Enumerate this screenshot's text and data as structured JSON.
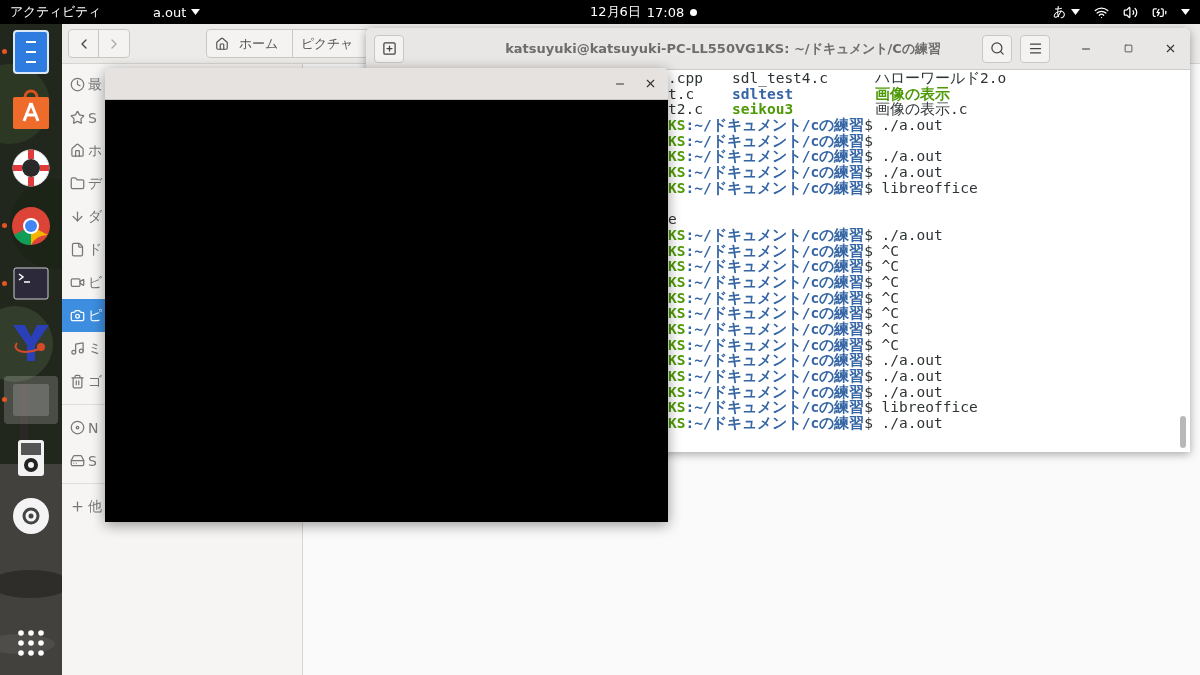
{
  "top_bar": {
    "activities": "アクティビティ",
    "app_menu": "a.out",
    "date": "12月6日",
    "time": "17:08",
    "input_method": "あ"
  },
  "dock": {
    "apps": [
      {
        "running": true,
        "selected": false
      },
      {
        "running": false,
        "selected": false
      },
      {
        "running": false,
        "selected": false
      },
      {
        "running": true,
        "selected": false
      },
      {
        "running": true,
        "selected": false
      },
      {
        "running": false,
        "selected": false
      },
      {
        "running": true,
        "selected": true
      },
      {
        "running": false,
        "selected": false
      },
      {
        "running": false,
        "selected": false
      }
    ]
  },
  "file_manager": {
    "path": [
      "ホーム",
      "ピクチャ"
    ],
    "sidebar": {
      "sections": [
        {
          "items": [
            {
              "label": "最",
              "selected": false
            },
            {
              "label": "S",
              "selected": false
            },
            {
              "label": "ホ",
              "selected": false
            },
            {
              "label": "デ",
              "selected": false
            },
            {
              "label": "ダ",
              "selected": false
            },
            {
              "label": "ド",
              "selected": false
            },
            {
              "label": "ビ",
              "selected": false
            },
            {
              "label": "ピ",
              "selected": true
            },
            {
              "label": "ミ",
              "selected": false
            },
            {
              "label": "ゴ",
              "selected": false
            }
          ]
        },
        {
          "items": [
            {
              "label": "N",
              "selected": false
            },
            {
              "label": "S",
              "selected": false
            }
          ]
        },
        {
          "items": [
            {
              "label": "他",
              "selected": false
            }
          ]
        }
      ]
    }
  },
  "terminal": {
    "title": "katsuyuki@katsuyuki-PC-LL550VG1KS: ~/ドキュメント/Cの練習",
    "lines": [
      {
        "kind": "listing",
        "cells": [
          {
            "text": ".cpp",
            "kind": "file"
          },
          {
            "text": "sdl_test4.c",
            "kind": "file"
          },
          {
            "text": "ハローワールド2.o",
            "kind": "file"
          }
        ]
      },
      {
        "kind": "listing",
        "cells": [
          {
            "text": "t.c",
            "kind": "file"
          },
          {
            "text": "sdltest",
            "kind": "directory"
          },
          {
            "text": "画像の表示",
            "kind": "executable"
          }
        ]
      },
      {
        "kind": "listing",
        "cells": [
          {
            "text": "t2.c",
            "kind": "file"
          },
          {
            "text": "seikou3",
            "kind": "executable"
          },
          {
            "text": "画像の表示.c",
            "kind": "file"
          }
        ]
      },
      {
        "kind": "prompt",
        "user": "KS",
        "path": ":~/ドキュメント/cの練習",
        "command": "$ ./a.out"
      },
      {
        "kind": "prompt",
        "user": "KS",
        "path": ":~/ドキュメント/cの練習",
        "command": "$"
      },
      {
        "kind": "prompt",
        "user": "KS",
        "path": ":~/ドキュメント/cの練習",
        "command": "$ ./a.out"
      },
      {
        "kind": "prompt",
        "user": "KS",
        "path": ":~/ドキュメント/cの練習",
        "command": "$ ./a.out"
      },
      {
        "kind": "prompt",
        "user": "KS",
        "path": ":~/ドキュメント/cの練習",
        "command": "$ libreoffice"
      },
      {
        "kind": "blank"
      },
      {
        "kind": "output",
        "text": "e"
      },
      {
        "kind": "prompt",
        "user": "KS",
        "path": ":~/ドキュメント/cの練習",
        "command": "$ ./a.out"
      },
      {
        "kind": "prompt",
        "user": "KS",
        "path": ":~/ドキュメント/cの練習",
        "command": "$ ^C"
      },
      {
        "kind": "prompt",
        "user": "KS",
        "path": ":~/ドキュメント/cの練習",
        "command": "$ ^C"
      },
      {
        "kind": "prompt",
        "user": "KS",
        "path": ":~/ドキュメント/cの練習",
        "command": "$ ^C"
      },
      {
        "kind": "prompt",
        "user": "KS",
        "path": ":~/ドキュメント/cの練習",
        "command": "$ ^C"
      },
      {
        "kind": "prompt",
        "user": "KS",
        "path": ":~/ドキュメント/cの練習",
        "command": "$ ^C"
      },
      {
        "kind": "prompt",
        "user": "KS",
        "path": ":~/ドキュメント/cの練習",
        "command": "$ ^C"
      },
      {
        "kind": "prompt",
        "user": "KS",
        "path": ":~/ドキュメント/cの練習",
        "command": "$ ^C"
      },
      {
        "kind": "prompt",
        "user": "KS",
        "path": ":~/ドキュメント/cの練習",
        "command": "$ ./a.out"
      },
      {
        "kind": "prompt",
        "user": "KS",
        "path": ":~/ドキュメント/cの練習",
        "command": "$ ./a.out"
      },
      {
        "kind": "prompt",
        "user": "KS",
        "path": ":~/ドキュメント/cの練習",
        "command": "$ ./a.out"
      },
      {
        "kind": "prompt",
        "user": "KS",
        "path": ":~/ドキュメント/cの練習",
        "command": "$ libreoffice"
      },
      {
        "kind": "prompt",
        "user": "KS",
        "path": ":~/ドキュメント/cの練習",
        "command": "$ ./a.out"
      }
    ]
  }
}
